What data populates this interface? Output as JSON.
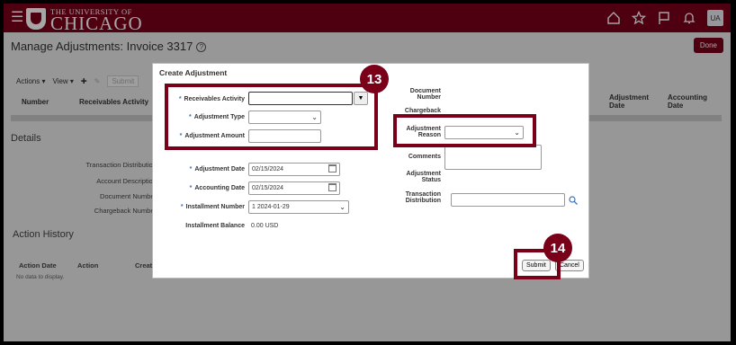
{
  "header": {
    "logo_top": "THE UNIVERSITY OF",
    "logo_main": "CHICAGO",
    "avatar": "UA"
  },
  "page": {
    "title": "Manage Adjustments: Invoice 3317",
    "done": "Done"
  },
  "toolbar": {
    "actions": "Actions ▾",
    "view": "View ▾",
    "add": "✚",
    "edit": "✎",
    "submit": "Submit"
  },
  "table": {
    "columns": [
      "Number",
      "Receivables Activity",
      "Adjustment Date",
      "Accounting Date"
    ]
  },
  "details": {
    "title": "Details",
    "labels": [
      "Transaction Distribution",
      "Account Description",
      "Document Number",
      "Chargeback Number"
    ]
  },
  "history": {
    "title": "Action History",
    "columns": [
      "Action Date",
      "Action",
      "Create"
    ],
    "empty": "No data to display."
  },
  "dialog": {
    "title": "Create Adjustment",
    "receivables_activity": {
      "label": "Receivables Activity",
      "value": ""
    },
    "adjustment_type": {
      "label": "Adjustment Type",
      "value": ""
    },
    "adjustment_amount": {
      "label": "Adjustment Amount",
      "value": ""
    },
    "adjustment_date": {
      "label": "Adjustment Date",
      "value": "02/15/2024"
    },
    "accounting_date": {
      "label": "Accounting Date",
      "value": "02/15/2024"
    },
    "installment_number": {
      "label": "Installment Number",
      "value": "1 2024-01-29"
    },
    "installment_balance": {
      "label": "Installment Balance",
      "value": "0.00 USD"
    },
    "document_number": {
      "label": "Document Number"
    },
    "chargeback": {
      "label": "Chargeback"
    },
    "adjustment_reason": {
      "label": "Adjustment Reason",
      "value": ""
    },
    "comments": {
      "label": "Comments"
    },
    "adjustment_status": {
      "label": "Adjustment Status"
    },
    "transaction_distribution": {
      "label": "Transaction Distribution",
      "value": ""
    },
    "submit": "Submit",
    "cancel": "Cancel"
  },
  "callouts": {
    "step_13": "13",
    "step_14": "14"
  },
  "colors": {
    "brand": "#7a0019",
    "required": "#3b73b9"
  }
}
